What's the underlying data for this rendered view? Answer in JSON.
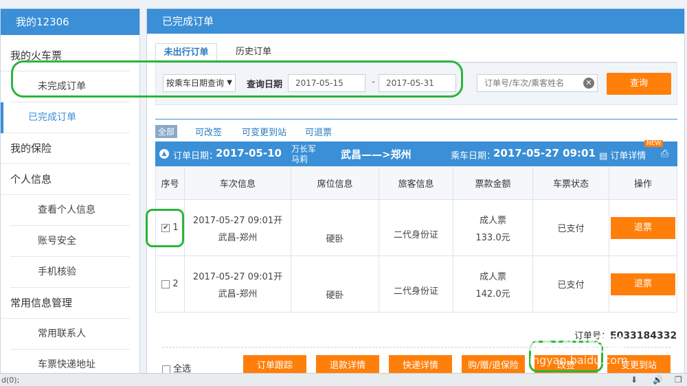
{
  "sidebar": {
    "title": "我的12306",
    "sec_tickets": "我的火车票",
    "item_unfinished": "未完成订单",
    "item_finished": "已完成订单",
    "sec_insurance": "我的保险",
    "sec_personal": "个人信息",
    "item_view_personal": "查看个人信息",
    "item_account_security": "账号安全",
    "item_phone_verify": "手机核验",
    "sec_common_info": "常用信息管理",
    "item_contacts": "常用联系人",
    "item_delivery": "车票快递地址"
  },
  "main": {
    "title": "已完成订单",
    "tab_active": "未出行订单",
    "tab_history": "历史订单"
  },
  "search": {
    "mode": "按乘车日期查询",
    "date_label": "查询日期",
    "start_date": "2017-05-15",
    "separator": "-",
    "end_date": "2017-05-31",
    "keyword_placeholder": "订单号/车次/乘客姓名",
    "button": "查询"
  },
  "filters": [
    "全部",
    "可改签",
    "可变更到站",
    "可退票"
  ],
  "order": {
    "date_label": "订单日期：",
    "date": "2017-05-10",
    "passenger1": "万长军",
    "passenger2": "马莉",
    "route": "武昌——>郑州",
    "depart_label": "乘车日期：",
    "depart": "2017-05-27 09:01",
    "detail": "订单详情",
    "new_badge": "NEW",
    "number_label": "订单号：",
    "number": "E033184332"
  },
  "table": {
    "headers": [
      "序号",
      "车次信息",
      "席位信息",
      "旅客信息",
      "票款金额",
      "车票状态",
      "操作"
    ],
    "rows": [
      {
        "index": "1",
        "checked": "✔",
        "train_time": "2017-05-27 09:01开",
        "train_route": "武昌-郑州",
        "seat": "硬卧",
        "passenger": "二代身份证",
        "ticket_type": "成人票",
        "price": "133.0元",
        "status": "已支付",
        "action": "退票"
      },
      {
        "index": "2",
        "checked": "",
        "train_time": "2017-05-27 09:01开",
        "train_route": "武昌-郑州",
        "seat": "硬卧",
        "passenger": "二代身份证",
        "ticket_type": "成人票",
        "price": "142.0元",
        "status": "已支付",
        "action": "退票"
      }
    ]
  },
  "footer": {
    "select_all": "全选",
    "actions": [
      "订单跟踪",
      "退款详情",
      "快递详情",
      "购/赠/退保险",
      "改签",
      "变更到站"
    ]
  },
  "watermark": {
    "line1": "Baidu经验",
    "line2": "jingyan.baidu.com"
  },
  "statusbar": {
    "text": "d(0);"
  },
  "colors": {
    "brand": "#3a8fd6",
    "accent": "#ff7f0a",
    "highlight": "#2bb43a"
  }
}
